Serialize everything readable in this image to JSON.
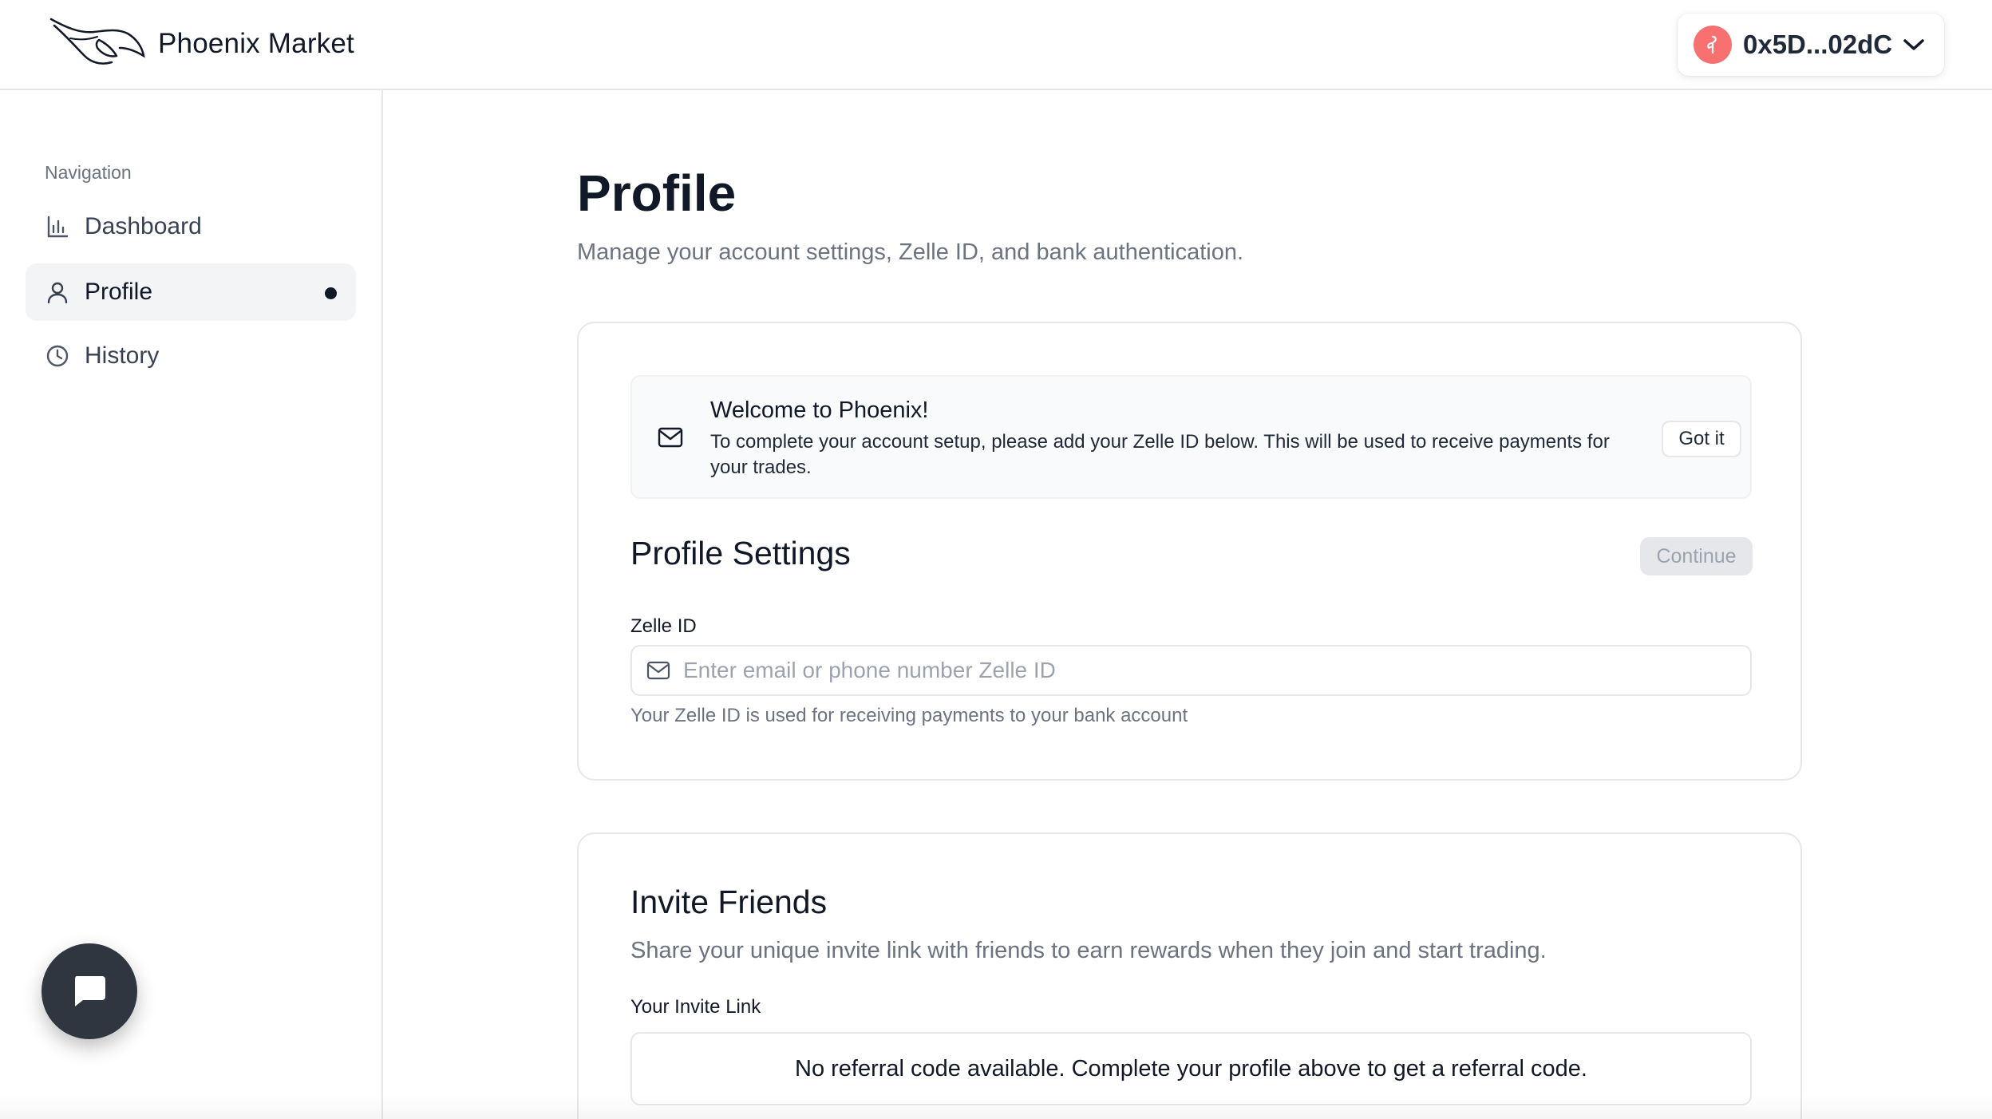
{
  "header": {
    "brand_name": "Phoenix Market",
    "wallet_address": "0x5D...02dC",
    "wallet_avatar_color": "#f87171"
  },
  "sidebar": {
    "heading": "Navigation",
    "items": [
      {
        "label": "Dashboard",
        "icon": "bar-chart-icon",
        "active": false
      },
      {
        "label": "Profile",
        "icon": "user-icon",
        "active": true
      },
      {
        "label": "History",
        "icon": "clock-icon",
        "active": false
      }
    ]
  },
  "main": {
    "title": "Profile",
    "subtitle": "Manage your account settings, Zelle ID, and bank authentication.",
    "welcome_alert": {
      "title": "Welcome to Phoenix!",
      "text": "To complete your account setup, please add your Zelle ID below. This will be used to receive payments for your trades.",
      "dismiss_label": "Got it"
    },
    "profile_settings": {
      "title": "Profile Settings",
      "continue_label": "Continue",
      "zelle_label": "Zelle ID",
      "zelle_value": "",
      "zelle_placeholder": "Enter email or phone number Zelle ID",
      "zelle_help": "Your Zelle ID is used for receiving payments to your bank account"
    },
    "invite": {
      "title": "Invite Friends",
      "subtitle": "Share your unique invite link with friends to earn rewards when they join and start trading.",
      "link_label": "Your Invite Link",
      "referral_message": "No referral code available. Complete your profile above to get a referral code."
    }
  }
}
